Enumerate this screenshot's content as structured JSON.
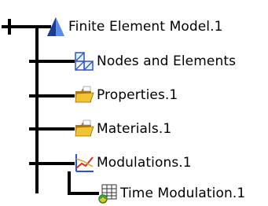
{
  "tree": {
    "root": {
      "label": "Finite Element Model.1",
      "icon": "finite-element-model-icon"
    },
    "children": [
      {
        "label": "Nodes and Elements",
        "icon": "nodes-and-elements-icon"
      },
      {
        "label": "Properties.1",
        "icon": "folder-icon"
      },
      {
        "label": "Materials.1",
        "icon": "folder-icon"
      },
      {
        "label": "Modulations.1",
        "icon": "modulations-icon",
        "children": [
          {
            "label": "Time Modulation.1",
            "icon": "time-modulation-icon"
          }
        ]
      }
    ]
  },
  "colors": {
    "line": "#000000",
    "folder": "#e8b020",
    "accent_blue": "#1f4fbf"
  }
}
